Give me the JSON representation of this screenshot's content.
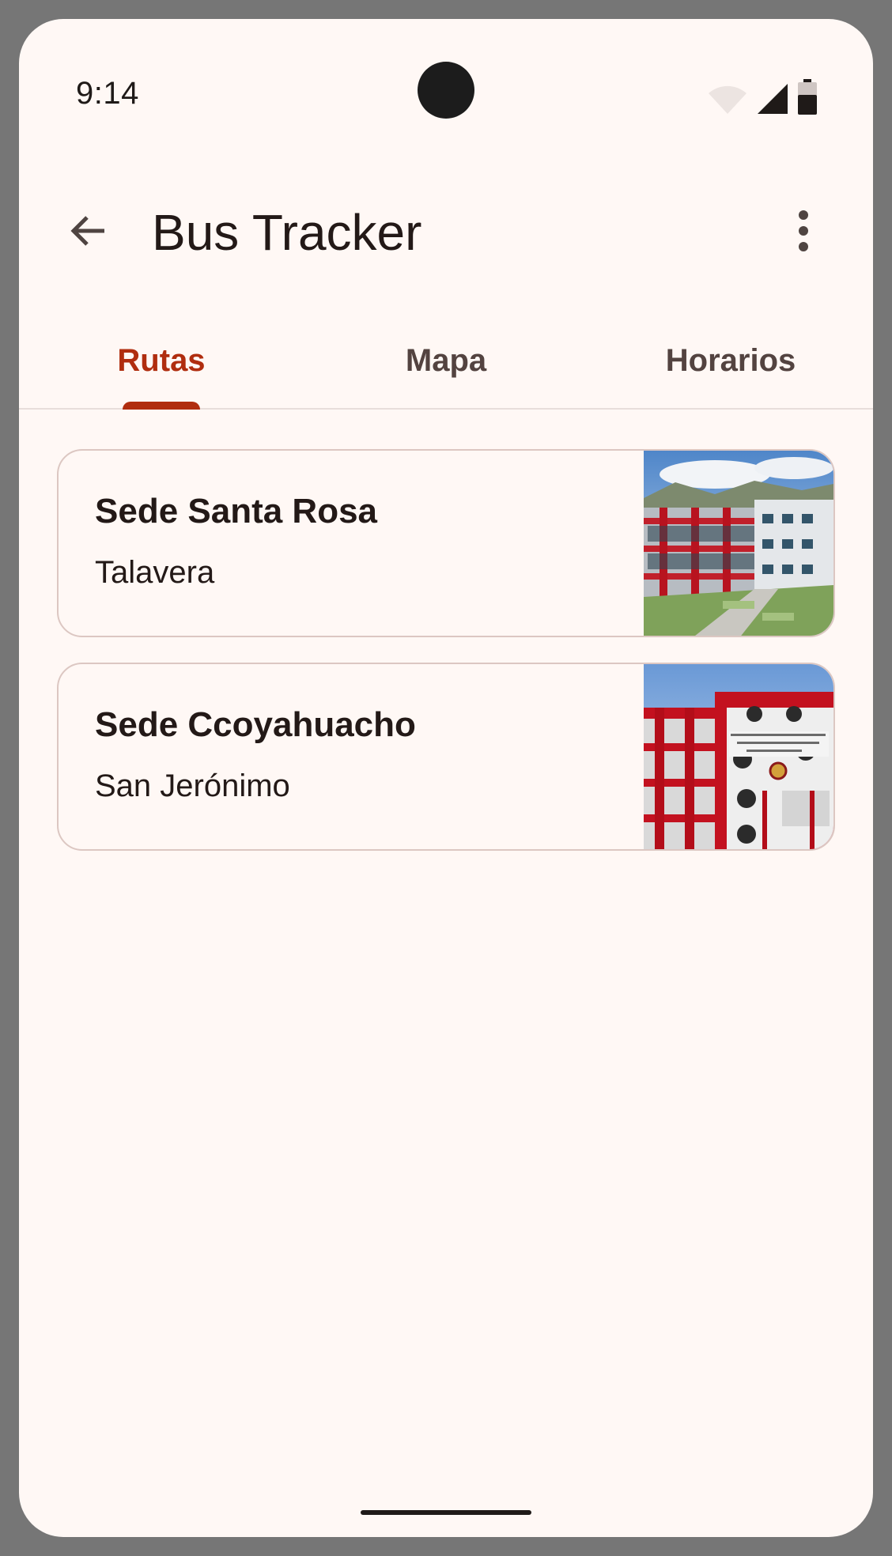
{
  "status_bar": {
    "time": "9:14",
    "icons": [
      "wifi-icon",
      "cell-signal-icon",
      "battery-icon"
    ]
  },
  "app_bar": {
    "back_icon": "arrow-back-icon",
    "title": "Bus Tracker",
    "menu_icon": "more-vert-icon"
  },
  "tabs": [
    {
      "label": "Rutas",
      "active": true
    },
    {
      "label": "Mapa",
      "active": false
    },
    {
      "label": "Horarios",
      "active": false
    }
  ],
  "routes": [
    {
      "name": "Sede Santa Rosa",
      "location": "Talavera",
      "image": "campus-building-photo"
    },
    {
      "name": "Sede Ccoyahuacho",
      "location": "San Jerónimo",
      "image": "school-building-photo"
    }
  ],
  "colors": {
    "accent": "#b02d0f",
    "background": "#fff8f5",
    "card_border": "#dcc7c2",
    "text": "#231917"
  }
}
